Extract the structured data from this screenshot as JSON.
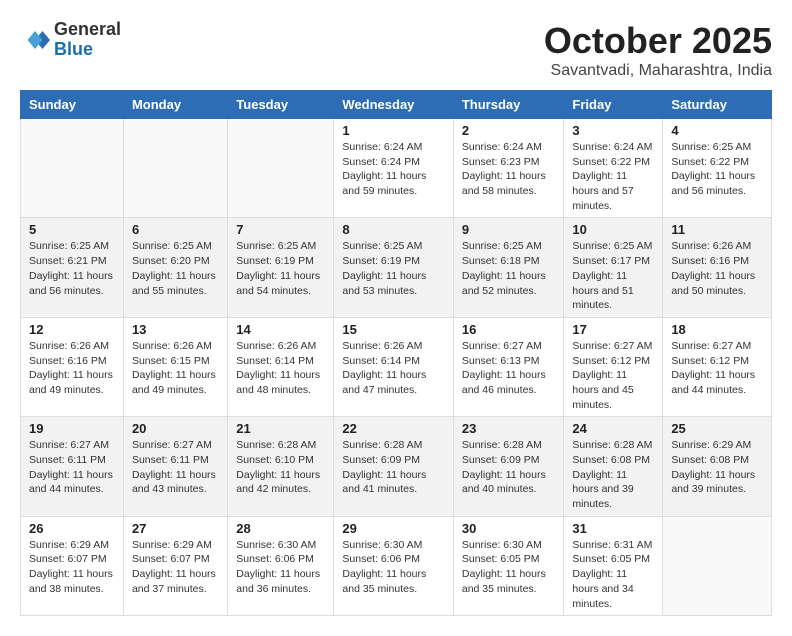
{
  "header": {
    "logo_general": "General",
    "logo_blue": "Blue",
    "title": "October 2025",
    "subtitle": "Savantvadi, Maharashtra, India"
  },
  "weekdays": [
    "Sunday",
    "Monday",
    "Tuesday",
    "Wednesday",
    "Thursday",
    "Friday",
    "Saturday"
  ],
  "weeks": [
    [
      {
        "day": "",
        "sunrise": "",
        "sunset": "",
        "daylight": ""
      },
      {
        "day": "",
        "sunrise": "",
        "sunset": "",
        "daylight": ""
      },
      {
        "day": "",
        "sunrise": "",
        "sunset": "",
        "daylight": ""
      },
      {
        "day": "1",
        "sunrise": "Sunrise: 6:24 AM",
        "sunset": "Sunset: 6:24 PM",
        "daylight": "Daylight: 11 hours and 59 minutes."
      },
      {
        "day": "2",
        "sunrise": "Sunrise: 6:24 AM",
        "sunset": "Sunset: 6:23 PM",
        "daylight": "Daylight: 11 hours and 58 minutes."
      },
      {
        "day": "3",
        "sunrise": "Sunrise: 6:24 AM",
        "sunset": "Sunset: 6:22 PM",
        "daylight": "Daylight: 11 hours and 57 minutes."
      },
      {
        "day": "4",
        "sunrise": "Sunrise: 6:25 AM",
        "sunset": "Sunset: 6:22 PM",
        "daylight": "Daylight: 11 hours and 56 minutes."
      }
    ],
    [
      {
        "day": "5",
        "sunrise": "Sunrise: 6:25 AM",
        "sunset": "Sunset: 6:21 PM",
        "daylight": "Daylight: 11 hours and 56 minutes."
      },
      {
        "day": "6",
        "sunrise": "Sunrise: 6:25 AM",
        "sunset": "Sunset: 6:20 PM",
        "daylight": "Daylight: 11 hours and 55 minutes."
      },
      {
        "day": "7",
        "sunrise": "Sunrise: 6:25 AM",
        "sunset": "Sunset: 6:19 PM",
        "daylight": "Daylight: 11 hours and 54 minutes."
      },
      {
        "day": "8",
        "sunrise": "Sunrise: 6:25 AM",
        "sunset": "Sunset: 6:19 PM",
        "daylight": "Daylight: 11 hours and 53 minutes."
      },
      {
        "day": "9",
        "sunrise": "Sunrise: 6:25 AM",
        "sunset": "Sunset: 6:18 PM",
        "daylight": "Daylight: 11 hours and 52 minutes."
      },
      {
        "day": "10",
        "sunrise": "Sunrise: 6:25 AM",
        "sunset": "Sunset: 6:17 PM",
        "daylight": "Daylight: 11 hours and 51 minutes."
      },
      {
        "day": "11",
        "sunrise": "Sunrise: 6:26 AM",
        "sunset": "Sunset: 6:16 PM",
        "daylight": "Daylight: 11 hours and 50 minutes."
      }
    ],
    [
      {
        "day": "12",
        "sunrise": "Sunrise: 6:26 AM",
        "sunset": "Sunset: 6:16 PM",
        "daylight": "Daylight: 11 hours and 49 minutes."
      },
      {
        "day": "13",
        "sunrise": "Sunrise: 6:26 AM",
        "sunset": "Sunset: 6:15 PM",
        "daylight": "Daylight: 11 hours and 49 minutes."
      },
      {
        "day": "14",
        "sunrise": "Sunrise: 6:26 AM",
        "sunset": "Sunset: 6:14 PM",
        "daylight": "Daylight: 11 hours and 48 minutes."
      },
      {
        "day": "15",
        "sunrise": "Sunrise: 6:26 AM",
        "sunset": "Sunset: 6:14 PM",
        "daylight": "Daylight: 11 hours and 47 minutes."
      },
      {
        "day": "16",
        "sunrise": "Sunrise: 6:27 AM",
        "sunset": "Sunset: 6:13 PM",
        "daylight": "Daylight: 11 hours and 46 minutes."
      },
      {
        "day": "17",
        "sunrise": "Sunrise: 6:27 AM",
        "sunset": "Sunset: 6:12 PM",
        "daylight": "Daylight: 11 hours and 45 minutes."
      },
      {
        "day": "18",
        "sunrise": "Sunrise: 6:27 AM",
        "sunset": "Sunset: 6:12 PM",
        "daylight": "Daylight: 11 hours and 44 minutes."
      }
    ],
    [
      {
        "day": "19",
        "sunrise": "Sunrise: 6:27 AM",
        "sunset": "Sunset: 6:11 PM",
        "daylight": "Daylight: 11 hours and 44 minutes."
      },
      {
        "day": "20",
        "sunrise": "Sunrise: 6:27 AM",
        "sunset": "Sunset: 6:11 PM",
        "daylight": "Daylight: 11 hours and 43 minutes."
      },
      {
        "day": "21",
        "sunrise": "Sunrise: 6:28 AM",
        "sunset": "Sunset: 6:10 PM",
        "daylight": "Daylight: 11 hours and 42 minutes."
      },
      {
        "day": "22",
        "sunrise": "Sunrise: 6:28 AM",
        "sunset": "Sunset: 6:09 PM",
        "daylight": "Daylight: 11 hours and 41 minutes."
      },
      {
        "day": "23",
        "sunrise": "Sunrise: 6:28 AM",
        "sunset": "Sunset: 6:09 PM",
        "daylight": "Daylight: 11 hours and 40 minutes."
      },
      {
        "day": "24",
        "sunrise": "Sunrise: 6:28 AM",
        "sunset": "Sunset: 6:08 PM",
        "daylight": "Daylight: 11 hours and 39 minutes."
      },
      {
        "day": "25",
        "sunrise": "Sunrise: 6:29 AM",
        "sunset": "Sunset: 6:08 PM",
        "daylight": "Daylight: 11 hours and 39 minutes."
      }
    ],
    [
      {
        "day": "26",
        "sunrise": "Sunrise: 6:29 AM",
        "sunset": "Sunset: 6:07 PM",
        "daylight": "Daylight: 11 hours and 38 minutes."
      },
      {
        "day": "27",
        "sunrise": "Sunrise: 6:29 AM",
        "sunset": "Sunset: 6:07 PM",
        "daylight": "Daylight: 11 hours and 37 minutes."
      },
      {
        "day": "28",
        "sunrise": "Sunrise: 6:30 AM",
        "sunset": "Sunset: 6:06 PM",
        "daylight": "Daylight: 11 hours and 36 minutes."
      },
      {
        "day": "29",
        "sunrise": "Sunrise: 6:30 AM",
        "sunset": "Sunset: 6:06 PM",
        "daylight": "Daylight: 11 hours and 35 minutes."
      },
      {
        "day": "30",
        "sunrise": "Sunrise: 6:30 AM",
        "sunset": "Sunset: 6:05 PM",
        "daylight": "Daylight: 11 hours and 35 minutes."
      },
      {
        "day": "31",
        "sunrise": "Sunrise: 6:31 AM",
        "sunset": "Sunset: 6:05 PM",
        "daylight": "Daylight: 11 hours and 34 minutes."
      },
      {
        "day": "",
        "sunrise": "",
        "sunset": "",
        "daylight": ""
      }
    ]
  ]
}
